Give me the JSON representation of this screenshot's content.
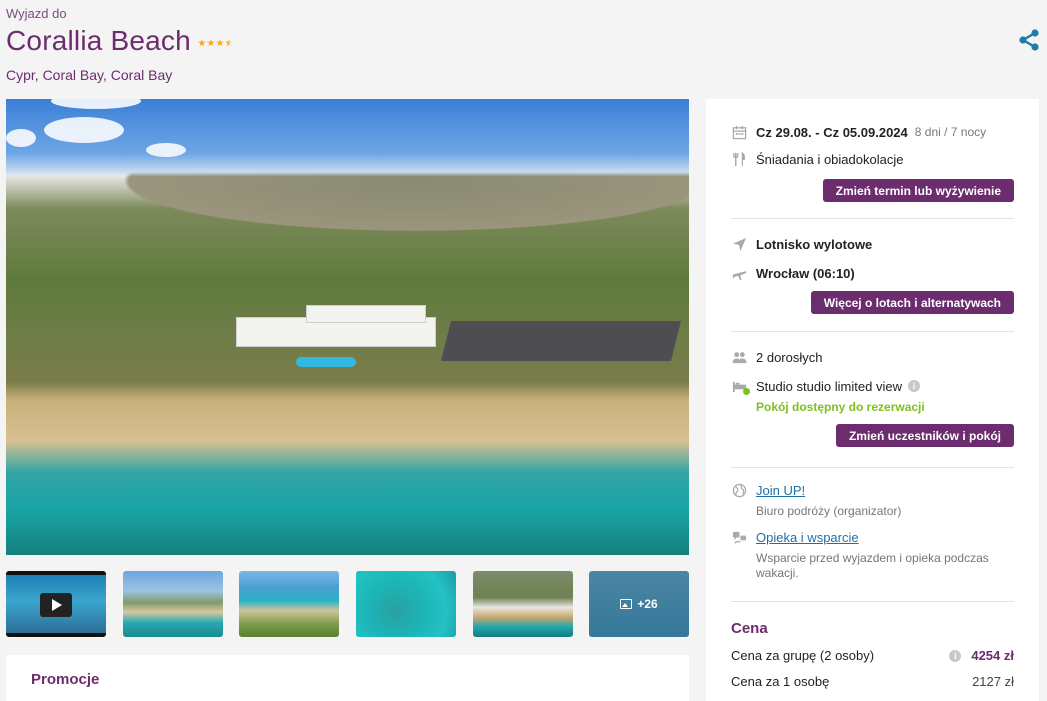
{
  "header": {
    "pre_title": "Wyjazd do",
    "hotel_name": "Corallia Beach",
    "stars": 3.5,
    "location": "Cypr, Coral Bay, Coral Bay"
  },
  "gallery": {
    "more_count_label": "+26",
    "thumbnails": [
      "video",
      "photo",
      "photo",
      "photo",
      "photo",
      "more"
    ]
  },
  "promo": {
    "title": "Promocje"
  },
  "sidebar": {
    "dates": {
      "range": "Cz 29.08. - Cz 05.09.2024",
      "duration": "8 dni / 7 nocy"
    },
    "board": "Śniadania i obiadokolacje",
    "change_term_button": "Zmień termin lub wyżywienie",
    "airport_label": "Lotnisko wylotowe",
    "airport_value": "Wrocław (06:10)",
    "flights_button": "Więcej o lotach i alternatywach",
    "participants": "2 dorosłych",
    "room": "Studio studio limited view",
    "room_status": "Pokój dostępny do rezerwacji",
    "change_participants_button": "Zmień uczestników i pokój",
    "organizer_link": "Join UP!",
    "organizer_desc": "Biuro podróży (organizator)",
    "support_link": "Opieka i wsparcie",
    "support_desc_line1": "Wsparcie przed wyjazdem i opieka podczas",
    "support_desc_line2": "wakacji.",
    "price": {
      "heading": "Cena",
      "group_label": "Cena za grupę (2 osoby)",
      "group_value": "4254 zł",
      "person_label": "Cena za 1 osobę",
      "person_value": "2127 zł"
    }
  },
  "colors": {
    "brand": "#6b2d6e",
    "link": "#1f6fa6",
    "available": "#7cc21f",
    "star": "#f6a821",
    "share": "#1d7fa8"
  }
}
